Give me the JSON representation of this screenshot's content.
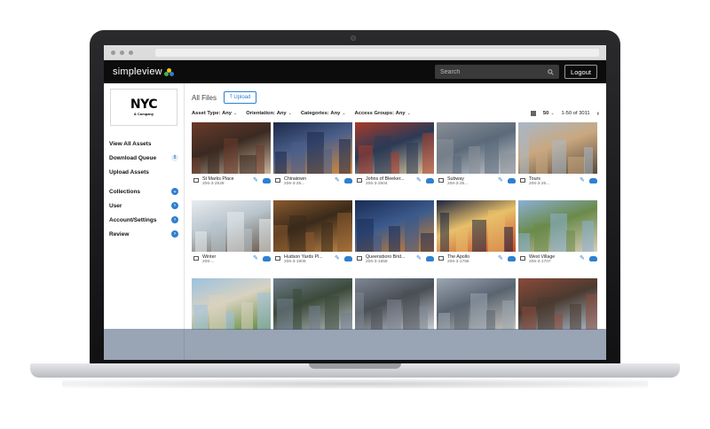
{
  "app": {
    "brand": "simpleview",
    "brand_colors": [
      "#f0c419",
      "#3cb34a",
      "#2f7fd1"
    ],
    "search_placeholder": "Search",
    "logout_label": "Logout"
  },
  "sidebar": {
    "logo": {
      "main": "NYC",
      "sub": "& Company"
    },
    "items": [
      {
        "label": "View All Assets",
        "indicator": ""
      },
      {
        "label": "Download Queue",
        "indicator": "0"
      },
      {
        "label": "Upload Assets",
        "indicator": ""
      },
      {
        "label": "Collections",
        "indicator": "chevron-down-icon"
      },
      {
        "label": "User",
        "indicator": "chevron-right-icon"
      },
      {
        "label": "Account/Settings",
        "indicator": "chevron-right-icon"
      },
      {
        "label": "Review",
        "indicator": "chevron-right-icon"
      }
    ]
  },
  "main": {
    "title": "All Files",
    "upload_label": "Upload",
    "filters": [
      {
        "label": "Asset Type:",
        "value": "Any"
      },
      {
        "label": "Orientation:",
        "value": "Any"
      },
      {
        "label": "Categories:",
        "value": "Any"
      },
      {
        "label": "Access Groups:",
        "value": "Any"
      }
    ],
    "per_page": "50",
    "range": "1-50 of 3011"
  },
  "assets": [
    {
      "name": "St Marks Place",
      "id": "206-3-2528",
      "palette": [
        "#6b3a2a",
        "#c9b49a",
        "#3a2a22"
      ]
    },
    {
      "name": "Chinatown",
      "id": "206-3-25...",
      "palette": [
        "#1c2a4a",
        "#d98b3a",
        "#4b5f8a"
      ]
    },
    {
      "name": "Johns of Bleeker...",
      "id": "206-3-2504",
      "palette": [
        "#a93a2a",
        "#e0c9a0",
        "#2b3a55"
      ]
    },
    {
      "name": "Subway",
      "id": "206-3-25...",
      "palette": [
        "#8a8f96",
        "#c9ccd1",
        "#5b6a7a"
      ]
    },
    {
      "name": "Tours",
      "id": "206-3-25...",
      "palette": [
        "#a8b8c8",
        "#5a4a3a",
        "#c9a880"
      ]
    },
    {
      "name": "Winter",
      "id": "206-...",
      "palette": [
        "#e8ecef",
        "#6b5a4a",
        "#b8c4cc"
      ]
    },
    {
      "name": "Hudson Yards Pl...",
      "id": "206-3-1909",
      "palette": [
        "#8a5a2e",
        "#c48a4a",
        "#3a2a1a"
      ]
    },
    {
      "name": "Queensboro Brid...",
      "id": "206-3-1858",
      "palette": [
        "#1a2c55",
        "#d9822b",
        "#3b5a8c"
      ]
    },
    {
      "name": "The Apollo",
      "id": "206-3-1786",
      "palette": [
        "#1c2540",
        "#c84a2a",
        "#e8c06a"
      ]
    },
    {
      "name": "West Village",
      "id": "206-3-1707",
      "palette": [
        "#8ab0d6",
        "#d8cdbb",
        "#6b8a4a"
      ]
    },
    {
      "name": "",
      "id": "",
      "palette": [
        "#9cc1e0",
        "#5e8a3a",
        "#d8d2c0"
      ]
    },
    {
      "name": "",
      "id": "",
      "palette": [
        "#6f7d8c",
        "#b5b9bd",
        "#3b4a3a"
      ]
    },
    {
      "name": "",
      "id": "",
      "palette": [
        "#7d8794",
        "#c9ccd1",
        "#4a4f56"
      ]
    },
    {
      "name": "",
      "id": "",
      "palette": [
        "#9aa6b2",
        "#c8c4bc",
        "#5a6470"
      ]
    },
    {
      "name": "",
      "id": "",
      "palette": [
        "#8a4a3a",
        "#a9b9c9",
        "#4b3a30"
      ]
    }
  ]
}
